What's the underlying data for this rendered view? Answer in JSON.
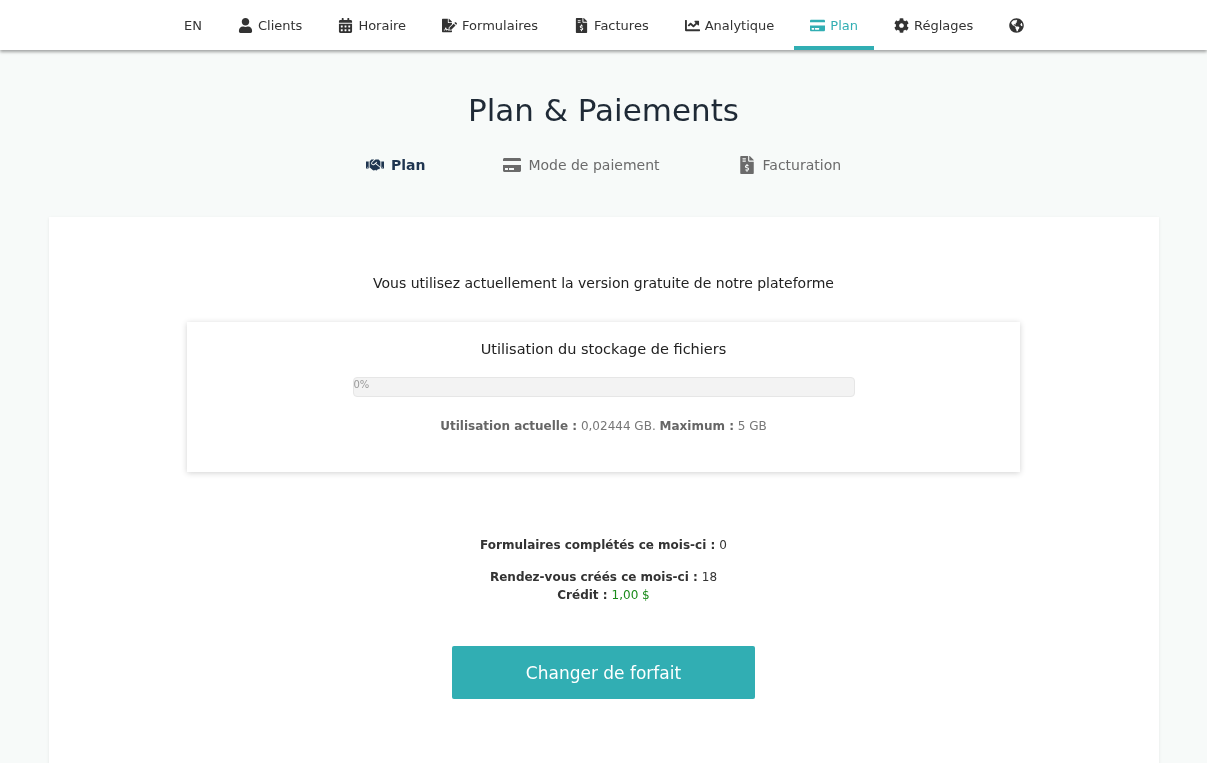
{
  "nav": {
    "items": [
      {
        "kind": "lang",
        "label": "EN",
        "selected": false
      },
      {
        "kind": "user",
        "label": "Clients",
        "selected": false
      },
      {
        "kind": "calendar",
        "label": "Horaire",
        "selected": false
      },
      {
        "kind": "form",
        "label": "Formulaires",
        "selected": false
      },
      {
        "kind": "invoice",
        "label": "Factures",
        "selected": false
      },
      {
        "kind": "chart",
        "label": "Analytique",
        "selected": false
      },
      {
        "kind": "card",
        "label": "Plan",
        "selected": true
      },
      {
        "kind": "gear",
        "label": "Réglages",
        "selected": false
      },
      {
        "kind": "globe",
        "selected": false
      }
    ]
  },
  "page_title": "Plan & Paiements",
  "tabs": [
    {
      "kind": "handshake",
      "label": "Plan",
      "selected": true
    },
    {
      "kind": "card",
      "label": "Mode de paiement",
      "selected": false
    },
    {
      "kind": "invoice",
      "label": "Facturation",
      "selected": false
    }
  ],
  "intro": "Vous utilisez actuellement la version gratuite de notre plateforme",
  "storage": {
    "title": "Utilisation du stockage de fichiers",
    "level": 0,
    "reading": "0%",
    "usage": "**Utilisation actuelle :** 0,02444 GB. **Maximum :** 5 GB"
  },
  "stats": [
    {
      "kind": "count",
      "label": "Formulaires complétés ce mois-ci :",
      "value": "0"
    },
    {
      "kind": "count",
      "label": "Rendez-vous créés ce mois-ci :",
      "value": "18"
    },
    {
      "kind": "currency",
      "label": "Crédit :",
      "value": "1,00 $"
    }
  ],
  "button": "Changer de forfait"
}
